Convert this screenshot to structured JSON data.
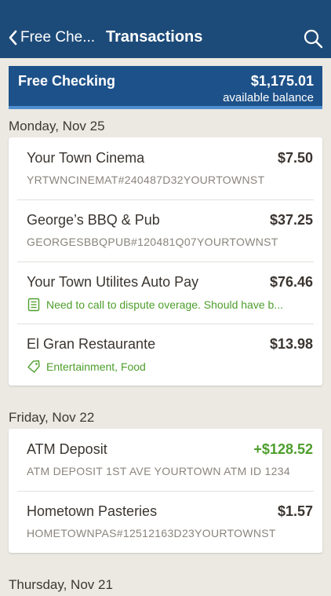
{
  "nav": {
    "back_label": "Free Che...",
    "title": "Transactions"
  },
  "account": {
    "name": "Free Checking",
    "balance": "$1,175.01",
    "balance_label": "available balance"
  },
  "sections": [
    {
      "date": "Monday, Nov 25",
      "transactions": [
        {
          "name": "Your Town Cinema",
          "amount": "$7.50",
          "detail": "YRTWNCINEMAT#240487D32YOURTOWNST"
        },
        {
          "name": "George’s BBQ & Pub",
          "amount": "$37.25",
          "detail": "GEORGESBBQPUB#120481Q07YOURTOWNST"
        },
        {
          "name": "Your Town Utilites Auto Pay",
          "amount": "$76.46",
          "note": "Need to call to dispute overage. Should have b..."
        },
        {
          "name": "El Gran Restaurante",
          "amount": "$13.98",
          "tags": "Entertainment, Food"
        }
      ]
    },
    {
      "date": "Friday, Nov 22",
      "transactions": [
        {
          "name": "ATM Deposit",
          "amount": "+$128.52",
          "detail": "ATM DEPOSIT 1ST AVE YOURTOWN ATM ID 1234"
        },
        {
          "name": "Hometown Pasteries",
          "amount": "$1.57",
          "detail": "HOMETOWNPAS#12512163D23YOURTOWNST"
        }
      ]
    },
    {
      "date": "Thursday, Nov 21"
    }
  ],
  "colors": {
    "navbar": "#1d4b79",
    "account_bar": "#1d5189",
    "credit": "#4d9e2b",
    "background": "#ece9e3"
  }
}
